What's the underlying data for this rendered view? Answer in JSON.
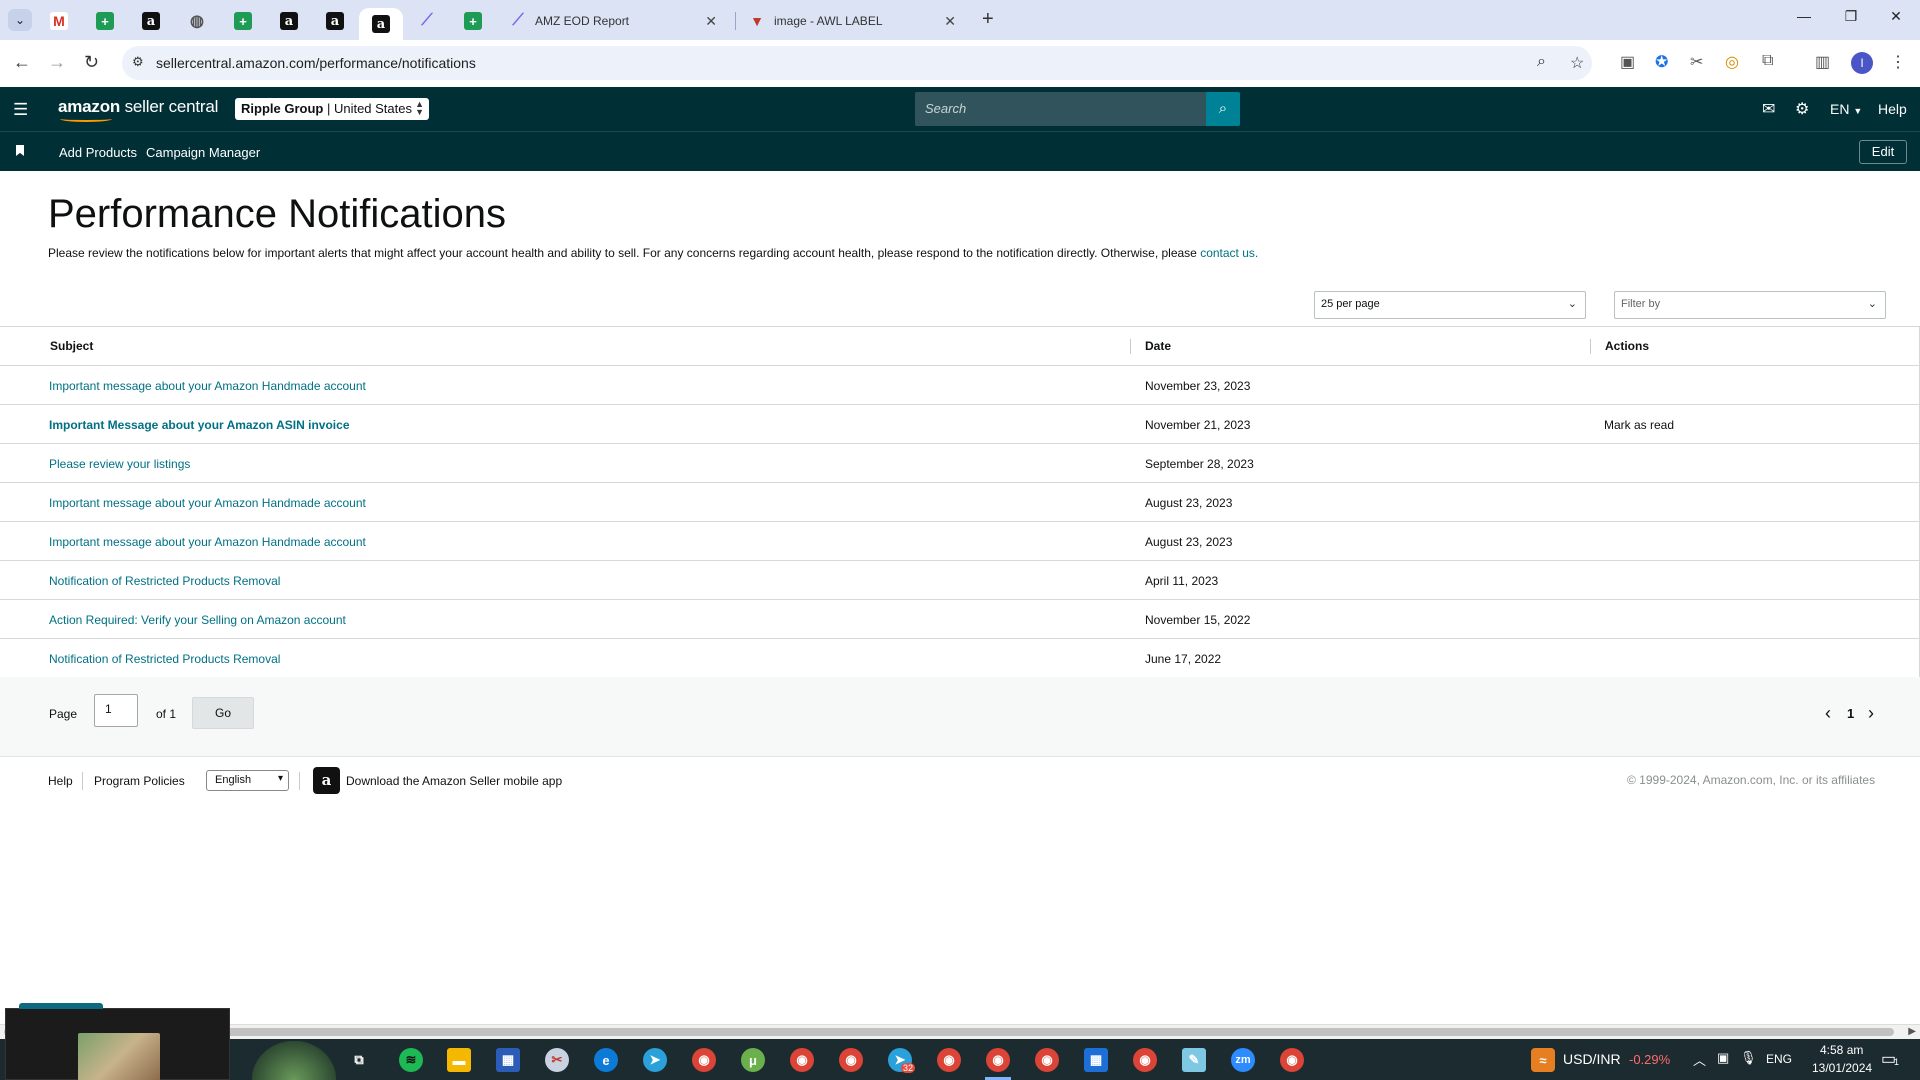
{
  "browser": {
    "tabs": [
      {
        "icon": "gmail-icon",
        "glyph": "M"
      },
      {
        "icon": "sheets-icon",
        "glyph": "+"
      },
      {
        "icon": "amazon-icon",
        "glyph": "a"
      },
      {
        "icon": "globe-icon",
        "glyph": "◍"
      },
      {
        "icon": "sheets-icon",
        "glyph": "+"
      },
      {
        "icon": "amazon-icon",
        "glyph": "a"
      },
      {
        "icon": "amazon-icon",
        "glyph": "a"
      },
      {
        "icon": "amazon-icon",
        "glyph": "a"
      },
      {
        "icon": "clickup-icon",
        "glyph": "⟋"
      },
      {
        "icon": "sheets-icon",
        "glyph": "+"
      }
    ],
    "full_tabs": [
      {
        "title": "AMZ EOD Report",
        "icon": "clickup-icon"
      },
      {
        "title": "image - AWL LABEL",
        "icon": "label-icon"
      }
    ],
    "url": "sellercentral.amazon.com/performance/notifications"
  },
  "header": {
    "brand_bold": "amazon",
    "brand_rest": " seller central",
    "store_bold": "Ripple Group",
    "store_rest": " | United States",
    "search_placeholder": "Search",
    "language": "EN",
    "help": "Help"
  },
  "bookmarks": {
    "items": [
      "Add Products",
      "Campaign Manager"
    ],
    "edit": "Edit"
  },
  "page": {
    "title": "Performance Notifications",
    "intro": "Please review the notifications below for important alerts that might affect your account health and ability to sell. For any concerns regarding account health, please respond to the notification directly. Otherwise, please ",
    "intro_link": "contact us.",
    "per_page": "25 per page",
    "filter_placeholder": "Filter by"
  },
  "table": {
    "columns": [
      "Subject",
      "Date",
      "Actions"
    ],
    "rows": [
      {
        "subject": "Important message about your Amazon Handmade account",
        "date": "November 23, 2023",
        "action": "",
        "unread": false
      },
      {
        "subject": "Important Message about your Amazon ASIN invoice",
        "date": "November 21, 2023",
        "action": "Mark as read",
        "unread": true
      },
      {
        "subject": "Please review your listings",
        "date": "September 28, 2023",
        "action": "",
        "unread": false
      },
      {
        "subject": "Important message about your Amazon Handmade account",
        "date": "August 23, 2023",
        "action": "",
        "unread": false
      },
      {
        "subject": "Important message about your Amazon Handmade account",
        "date": "August 23, 2023",
        "action": "",
        "unread": false
      },
      {
        "subject": "Notification of Restricted Products Removal",
        "date": "April 11, 2023",
        "action": "",
        "unread": false
      },
      {
        "subject": "Action Required: Verify your Selling on Amazon account",
        "date": "November 15, 2022",
        "action": "",
        "unread": false
      },
      {
        "subject": "Notification of Restricted Products Removal",
        "date": "June 17, 2022",
        "action": "",
        "unread": false
      }
    ]
  },
  "pager": {
    "label": "Page",
    "value": "1",
    "of": "of 1",
    "go": "Go",
    "prev": "‹",
    "current": "1",
    "next": "›"
  },
  "footer": {
    "help": "Help",
    "policies": "Program Policies",
    "language": "English",
    "app_text": "Download the Amazon Seller mobile app",
    "copyright": "© 1999-2024, Amazon.com, Inc. or its affiliates"
  },
  "taskbar": {
    "ticker": "USD/INR",
    "ticker_change": "-0.29%",
    "lang": "ENG",
    "time": "4:58 am",
    "date": "13/01/2024",
    "telegram_badge": "32",
    "notification_count": "1"
  },
  "colors": {
    "header_bg": "#002f36",
    "link": "#007185",
    "search_button": "#008296",
    "ticker_negative": "#ff6b6b"
  }
}
